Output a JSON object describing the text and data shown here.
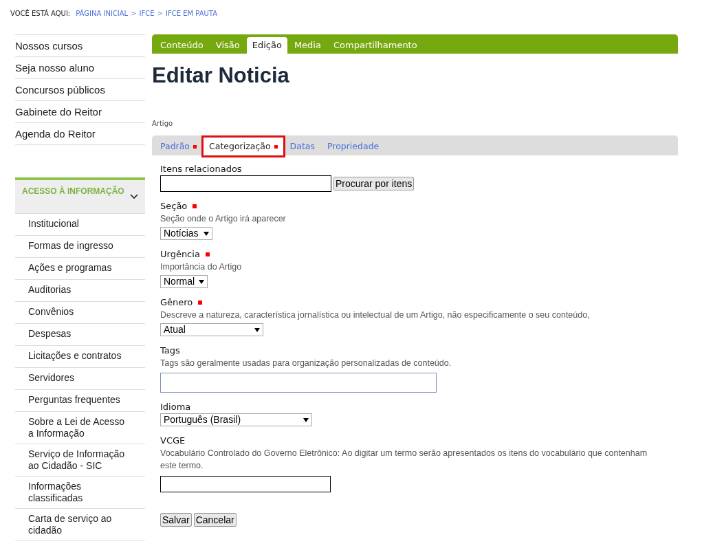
{
  "breadcrumb": {
    "label": "VOCÊ ESTÁ AQUI:",
    "items": [
      {
        "kind": "link",
        "text": "PÁGINA INICIAL"
      },
      {
        "kind": "separator",
        "text": ">"
      },
      {
        "kind": "link",
        "text": "IFCE"
      },
      {
        "kind": "separator",
        "text": ">"
      },
      {
        "kind": "link",
        "text": "IFCE EM PAUTA"
      }
    ]
  },
  "sidebar": {
    "items": [
      "Nossos cursos",
      "Seja nosso aluno",
      "Concursos públicos",
      "Gabinete do Reitor",
      "Agenda do Reitor"
    ],
    "section": {
      "title": "ACESSO À INFORMAÇÃO",
      "expanded": true,
      "items": [
        "Institucional",
        "Formas de ingresso",
        "Ações e programas",
        "Auditorias",
        "Convênios",
        "Despesas",
        "Licitações e contratos",
        "Servidores",
        "Perguntas frequentes",
        "Sobre a Lei de Acesso a Informação",
        "Serviço de Informação ao Cidadão - SIC",
        "Informações classificadas",
        "Carta de serviço ao cidadão"
      ]
    }
  },
  "content_tabs": [
    {
      "label": "Conteúdo",
      "selected": false
    },
    {
      "label": "Visão",
      "selected": false
    },
    {
      "label": "Edição",
      "selected": true
    },
    {
      "label": "Media",
      "selected": false
    },
    {
      "label": "Compartilhamento",
      "selected": false
    }
  ],
  "title": "Editar Noticia",
  "type_label": "Artigo",
  "form_tabs": [
    {
      "label": "Padrão",
      "selected": false,
      "required": true,
      "highlighted": false
    },
    {
      "label": "Categorização",
      "selected": true,
      "required": true,
      "highlighted": true
    },
    {
      "label": "Datas",
      "selected": false,
      "required": false,
      "highlighted": false
    },
    {
      "label": "Propriedade",
      "selected": false,
      "required": false,
      "highlighted": false
    }
  ],
  "fields": [
    {
      "kind": "search",
      "label": "Itens relacionados",
      "required": false,
      "button": "Procurar por itens"
    },
    {
      "kind": "select",
      "label": "Seção",
      "required": true,
      "help": "Seção onde o Artigo irá aparecer",
      "value": "Notícias"
    },
    {
      "kind": "select",
      "label": "Urgência",
      "required": true,
      "help": "Importância do Artigo",
      "value": "Normal"
    },
    {
      "kind": "select",
      "label": "Gênero",
      "required": true,
      "help": "Descreve a natureza, característica jornalística ou intelectual de um Artigo, não especificamente o seu conteúdo,",
      "value": "Atual"
    },
    {
      "kind": "tags",
      "label": "Tags",
      "required": false,
      "help": "Tags são geralmente usadas para organização personalizadas de conteúdo."
    },
    {
      "kind": "select",
      "label": "Idioma",
      "required": false,
      "value": "Português (Brasil)"
    },
    {
      "kind": "text",
      "label": "VCGE",
      "required": false,
      "help": "Vocabulário Controlado do Governo Eletrônico: Ao digitar um termo serão apresentados os itens do vocabulário que contenham este termo."
    }
  ],
  "buttons": [
    "Salvar",
    "Cancelar"
  ]
}
